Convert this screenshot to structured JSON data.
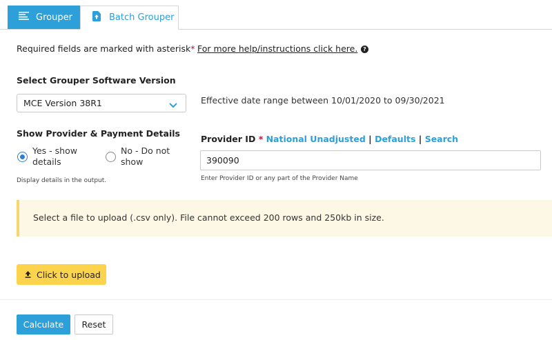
{
  "tabs": [
    {
      "label": "Grouper",
      "icon": "list-icon",
      "active": true
    },
    {
      "label": "Batch Grouper",
      "icon": "file-upload-icon",
      "active": false
    }
  ],
  "required_note": {
    "text": "Required fields are marked with asterisk",
    "star": "*"
  },
  "help": {
    "link": "For more help/instructions click here.",
    "icon": "question-circle-icon"
  },
  "grouper_version": {
    "label": "Select Grouper Software Version",
    "selected": "MCE Version 38R1",
    "effective": "Effective date range between 10/01/2020 to 09/30/2021"
  },
  "payment_details": {
    "label": "Show Provider & Payment Details",
    "options": [
      {
        "line1": "Yes - show",
        "line2": "details",
        "selected": true
      },
      {
        "line1": "No - Do not",
        "line2": "show",
        "selected": false
      }
    ],
    "hint": "Display details in the output."
  },
  "provider": {
    "label": "Provider ID",
    "star": "*",
    "links": [
      "National Unadjusted",
      "Defaults",
      "Search"
    ],
    "separator": "|",
    "value": "390090",
    "hint": "Enter Provider ID or any part of the Provider Name"
  },
  "upload_notice": "Select a file to upload (.csv only). File cannot exceed 200 rows and 250kb in size.",
  "upload_button": "Click to upload",
  "actions": {
    "calculate": "Calculate",
    "reset": "Reset"
  },
  "colors": {
    "accent": "#2d9fd9",
    "required": "#c8102e",
    "notice_bg": "#fdf8e6",
    "upload": "#fcd34d"
  }
}
